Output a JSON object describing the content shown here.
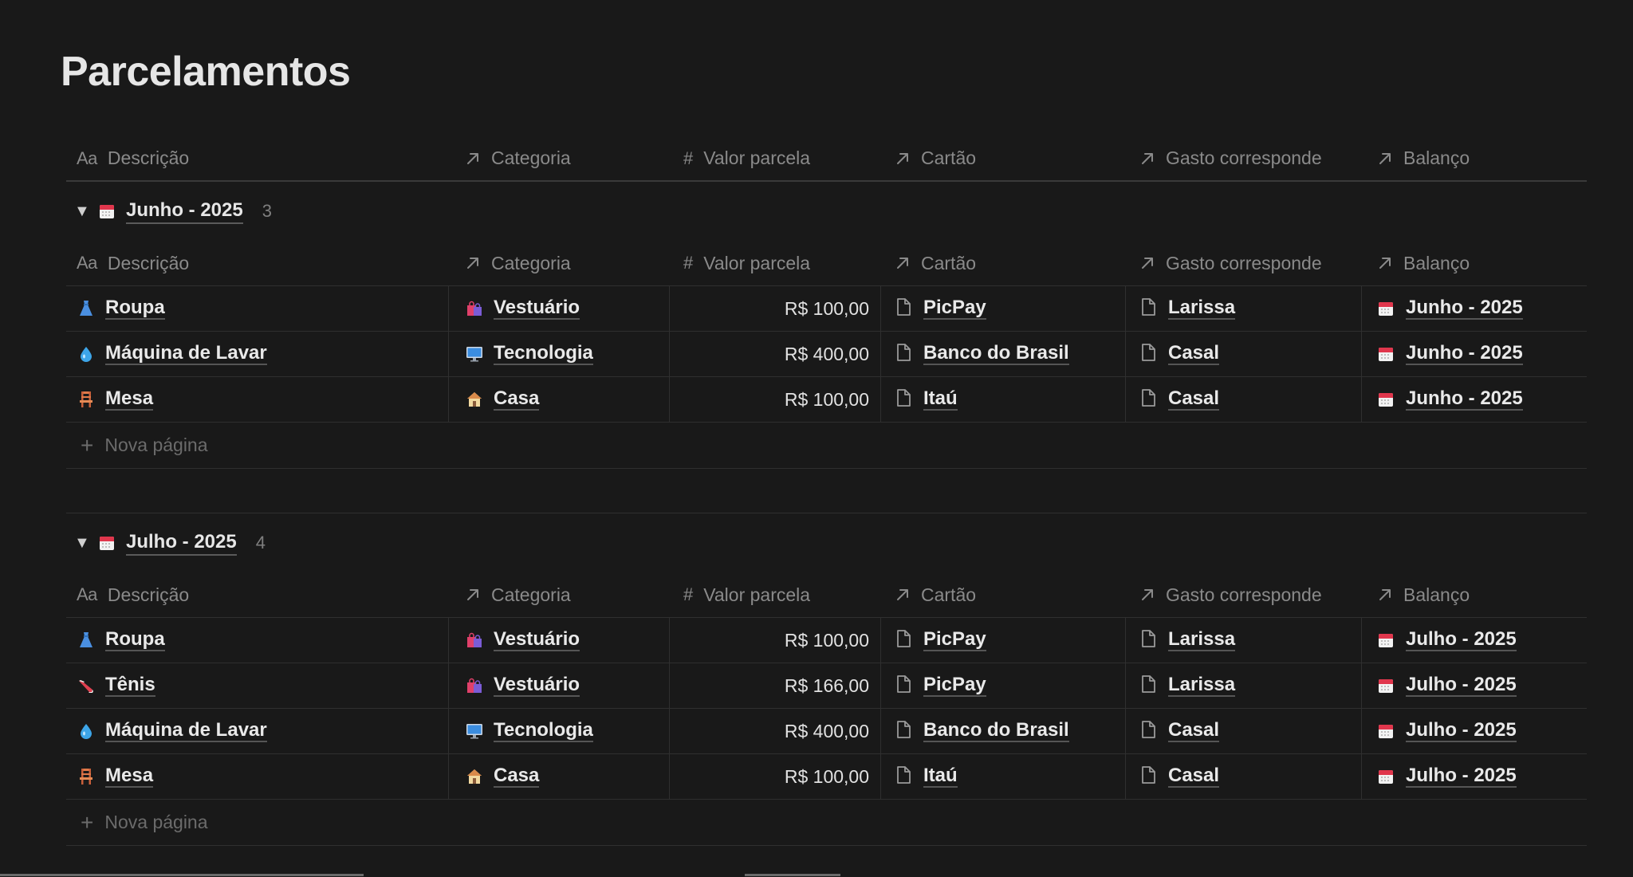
{
  "page": {
    "title": "Parcelamentos"
  },
  "columns": {
    "descricao": "Descrição",
    "descricao_icon": "Aa",
    "categoria": "Categoria",
    "valor": "Valor parcela",
    "valor_icon": "#",
    "cartao": "Cartão",
    "gasto": "Gasto corresponde",
    "balanco": "Balanço"
  },
  "new_page_label": "Nova página",
  "groups": [
    {
      "title": "Junho - 2025",
      "count": "3",
      "rows": [
        {
          "emoji": "dress-icon",
          "descricao": "Roupa",
          "categoria_icon": "shopping-bags-icon",
          "categoria": "Vestuário",
          "valor": "R$ 100,00",
          "cartao": "PicPay",
          "gasto": "Larissa",
          "balanco": "Junho - 2025"
        },
        {
          "emoji": "droplet-icon",
          "descricao": "Máquina de Lavar",
          "categoria_icon": "monitor-icon",
          "categoria": "Tecnologia",
          "valor": "R$ 400,00",
          "cartao": "Banco do Brasil",
          "gasto": "Casal",
          "balanco": "Junho - 2025"
        },
        {
          "emoji": "chair-icon",
          "descricao": "Mesa",
          "categoria_icon": "house-icon",
          "categoria": "Casa",
          "valor": "R$ 100,00",
          "cartao": "Itaú",
          "gasto": "Casal",
          "balanco": "Junho - 2025"
        }
      ]
    },
    {
      "title": "Julho - 2025",
      "count": "4",
      "rows": [
        {
          "emoji": "dress-icon",
          "descricao": "Roupa",
          "categoria_icon": "shopping-bags-icon",
          "categoria": "Vestuário",
          "valor": "R$ 100,00",
          "cartao": "PicPay",
          "gasto": "Larissa",
          "balanco": "Julho - 2025"
        },
        {
          "emoji": "sneaker-icon",
          "descricao": "Tênis",
          "categoria_icon": "shopping-bags-icon",
          "categoria": "Vestuário",
          "valor": "R$ 166,00",
          "cartao": "PicPay",
          "gasto": "Larissa",
          "balanco": "Julho - 2025"
        },
        {
          "emoji": "droplet-icon",
          "descricao": "Máquina de Lavar",
          "categoria_icon": "monitor-icon",
          "categoria": "Tecnologia",
          "valor": "R$ 400,00",
          "cartao": "Banco do Brasil",
          "gasto": "Casal",
          "balanco": "Julho - 2025"
        },
        {
          "emoji": "chair-icon",
          "descricao": "Mesa",
          "categoria_icon": "house-icon",
          "categoria": "Casa",
          "valor": "R$ 100,00",
          "cartao": "Itaú",
          "gasto": "Casal",
          "balanco": "Julho - 2025"
        }
      ]
    }
  ],
  "colors": {
    "background": "#191919",
    "text": "#e9e9e9",
    "muted": "#8a8a8a",
    "border": "#2f2f2f"
  }
}
